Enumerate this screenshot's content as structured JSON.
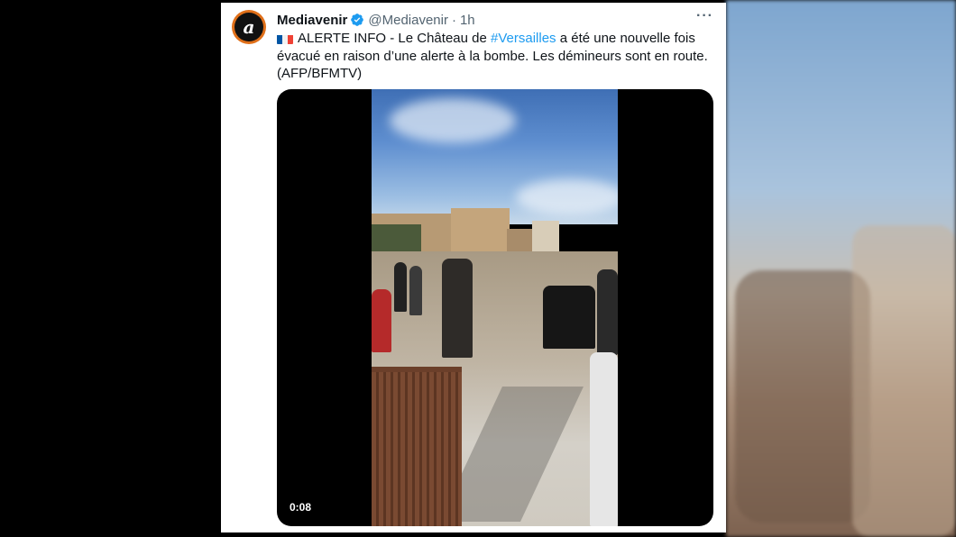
{
  "tweet": {
    "display_name": "Mediavenir",
    "handle": "@Mediavenir",
    "separator": "·",
    "time": "1h",
    "more_label": "···",
    "avatar_letter": "a",
    "text_before": "ALERTE INFO - Le Château de ",
    "hashtag": "#Versailles",
    "text_after": " a été une nouvelle fois évacué en raison d’une alerte à la bombe. Les démineurs sont en route. (AFP/BFMTV)",
    "video_duration": "0:08"
  },
  "colors": {
    "link": "#1d9bf0",
    "verified": "#1d9bf0",
    "avatar_ring": "#e0701a",
    "flag_blue": "#0055a4",
    "flag_white": "#ffffff",
    "flag_red": "#ef4135"
  },
  "icons": {
    "verified": "verified-badge-icon",
    "more": "more-options-icon",
    "flag": "france-flag-icon"
  }
}
